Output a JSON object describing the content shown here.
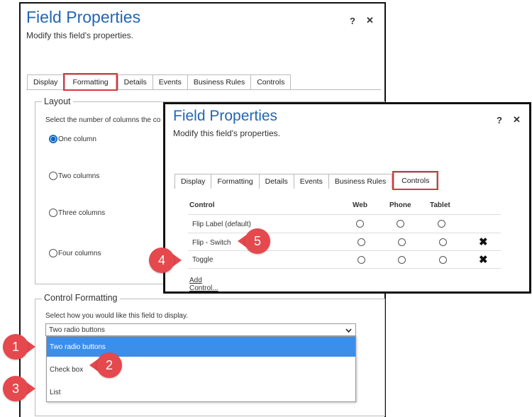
{
  "dialog_back": {
    "title": "Field Properties",
    "subtitle": "Modify this field's properties.",
    "help_label": "?",
    "close_label": "✕",
    "tabs": [
      "Display",
      "Formatting",
      "Details",
      "Events",
      "Business Rules",
      "Controls"
    ],
    "active_tab": "Formatting",
    "layout": {
      "legend": "Layout",
      "description": "Select the number of columns the co",
      "options": [
        "One column",
        "Two columns",
        "Three columns",
        "Four columns"
      ],
      "selected": "One column"
    },
    "control_formatting": {
      "legend": "Control Formatting",
      "description": "Select how you would like this field to display.",
      "select_value": "Two radio buttons",
      "options": [
        "Two radio buttons",
        "Check box",
        "List"
      ],
      "highlighted_option": "Two radio buttons"
    }
  },
  "dialog_front": {
    "title": "Field Properties",
    "subtitle": "Modify this field's properties.",
    "help_label": "?",
    "close_label": "✕",
    "tabs": [
      "Display",
      "Formatting",
      "Details",
      "Events",
      "Business Rules",
      "Controls"
    ],
    "active_tab": "Controls",
    "table": {
      "headers": [
        "Control",
        "Web",
        "Phone",
        "Tablet"
      ],
      "rows": [
        {
          "control": "Flip Label (default)",
          "removable": false
        },
        {
          "control": "Flip - Switch",
          "removable": true
        },
        {
          "control": "Toggle",
          "removable": true
        }
      ],
      "remove_label": "✖",
      "add_link": "Add Control..."
    }
  },
  "callouts": [
    "1",
    "2",
    "3",
    "4",
    "5"
  ],
  "colors": {
    "title_blue": "#2266b4",
    "highlight_red": "#e0363b",
    "callout_red": "#e5484d",
    "selected_option_bg": "#3b8eea"
  }
}
